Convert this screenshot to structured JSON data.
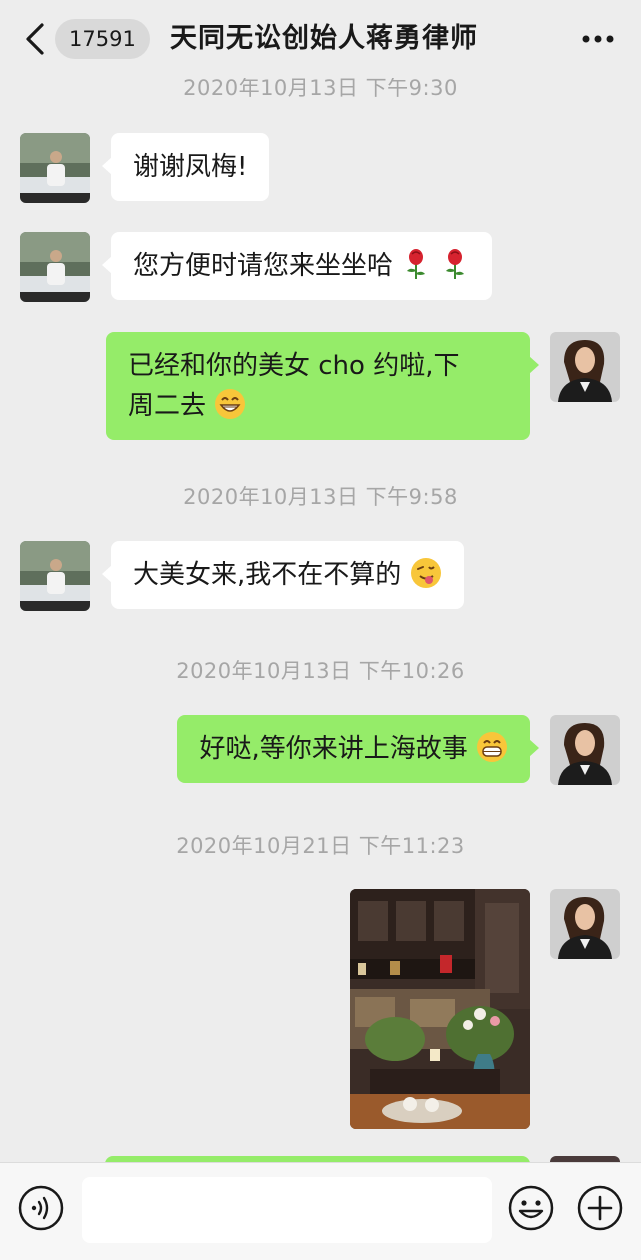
{
  "header": {
    "unread_count": "17591",
    "title": "天同无讼创始人蒋勇律师"
  },
  "colors": {
    "background": "#ededed",
    "incoming_bubble": "#ffffff",
    "outgoing_bubble": "#95ec69",
    "timestamp_text": "#a6a6a6"
  },
  "timestamps": [
    "2020年10月13日 下午9:30",
    "2020年10月13日 下午9:58",
    "2020年10月13日 下午10:26",
    "2020年10月21日 下午11:23"
  ],
  "messages": [
    {
      "direction": "in",
      "text": "谢谢凤梅!",
      "emoji": ""
    },
    {
      "direction": "in",
      "text": "您方便时请您来坐坐哈",
      "emoji": "rose-icon x2"
    },
    {
      "direction": "out",
      "line1": "已经和你的美女 cho 约啦,下",
      "line2": "周二去",
      "emoji": "grin-sweat-icon"
    },
    {
      "direction": "in",
      "text": "大美女来,我不在不算的",
      "emoji": "wink-tongue-icon"
    },
    {
      "direction": "out",
      "text": "好哒,等你来讲上海故事",
      "emoji": "grin-icon"
    },
    {
      "direction": "out",
      "type": "image",
      "emoji": "photo-of-living-room"
    }
  ],
  "input": {
    "placeholder": ""
  }
}
